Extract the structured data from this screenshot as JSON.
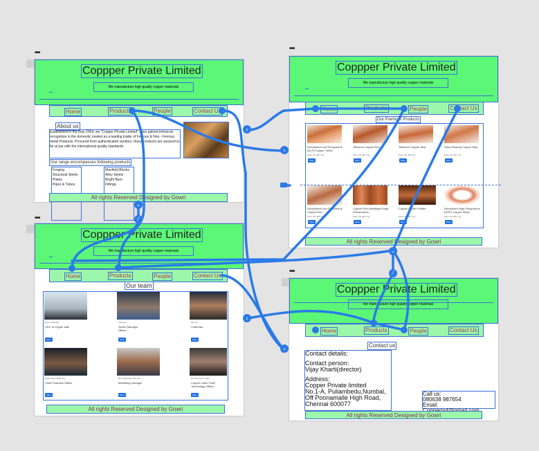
{
  "site": {
    "title": "Coppper Private Limited",
    "tagline": "We manufacture high quality copper materials",
    "header_button": "",
    "footer": "All rights Reserved  Designed by Gowri"
  },
  "nav": {
    "home": "Home",
    "products": "Products",
    "people": "People",
    "contact": "Contact Us"
  },
  "home_page": {
    "about_title": "About us",
    "about_text": "Established in the year 2004, we \"Copper Private Limited\" have gained immense recognition in the domestic market as a leading trader of Ferrous & Non - Ferrous metal Products. Procured from authenticated vendors, these products are assured to be at par with the international quality standards.",
    "range_title": "Our range encompasses following products",
    "range_left": [
      "Forging",
      "Structural Steels",
      "Plates",
      "Pipes & Tubes"
    ],
    "range_right": [
      "Manifold Blocks",
      "Alloy Steels",
      "Bright Bars",
      "Fittings"
    ]
  },
  "products_page": {
    "heading": "Our Premium Products",
    "products": [
      {
        "name": "Deoxidized Low Phosphorus (DLP) Copper Tubes",
        "price": "Price: Rs 495 / Kg",
        "button": "More"
      },
      {
        "name": "Tellurium Copper Rod",
        "price": "Price: Rs 495 / Kg",
        "button": "More"
      },
      {
        "name": "Tellurium Copper Strip",
        "price": "Price: Rs 495 / Kg",
        "button": "More"
      },
      {
        "name": "Silver Bearing Copper Strip",
        "price": "Price: Rs 495 / Kg",
        "button": "More"
      },
      {
        "name": "Deoxidized Low Phosphorus Copper Rod",
        "price": "Price: Rs 495 / Kg",
        "button": "More"
      },
      {
        "name": "Copper Rod (Weldright Soap Phosphorus)",
        "price": "Price: Rs 495 / Kg",
        "button": "More"
      },
      {
        "name": "Copper Nickel Profiles",
        "price": "Price: Rs 495 / Kg",
        "button": "More"
      },
      {
        "name": "Deoxidized High Phosphorus (DHP) Copper Strips",
        "price": "Price: Rs 495 / Kg",
        "button": "More"
      }
    ]
  },
  "people_page": {
    "heading": "Our team",
    "people": [
      {
        "name": "Ravi Kodikkara",
        "role": "CEO of copper latte",
        "button": "More"
      },
      {
        "name": "Andrews",
        "role": "Senior Manager Officer",
        "button": "More"
      },
      {
        "name": "Mondo",
        "role": "Chairman",
        "button": "More"
      },
      {
        "name": "Rajamaldi A Mahindra",
        "role": "Chief Financial Officer",
        "button": "More"
      },
      {
        "name": "Ben Rajamdhu Pramod",
        "role": "Marketing manager",
        "button": "More"
      },
      {
        "name": "Prof Samesh C.Jain",
        "role": "Copper Labor Chief Technology Officer",
        "button": "More"
      }
    ]
  },
  "contact_page": {
    "heading": "Contact us",
    "details_title": "Contact details:",
    "person_label": "Contact person:",
    "person": "Vijay Kharti(director)",
    "address_label": "Address:",
    "address_lines": [
      "Copper Private limited",
      "No.1-A, Puliambedu,Numbal,",
      "Off Poonamalle High Road,",
      "Chennai 600077"
    ],
    "call_label": "Call us:",
    "phone": "080638 987654",
    "email": "Email: Copperpvt@gmail.com"
  },
  "colors": {
    "header_green": "#5cf777",
    "nav_green": "#9cf7aa",
    "link_blue": "#2a7ae8",
    "canvas": "#e4e4e4"
  }
}
